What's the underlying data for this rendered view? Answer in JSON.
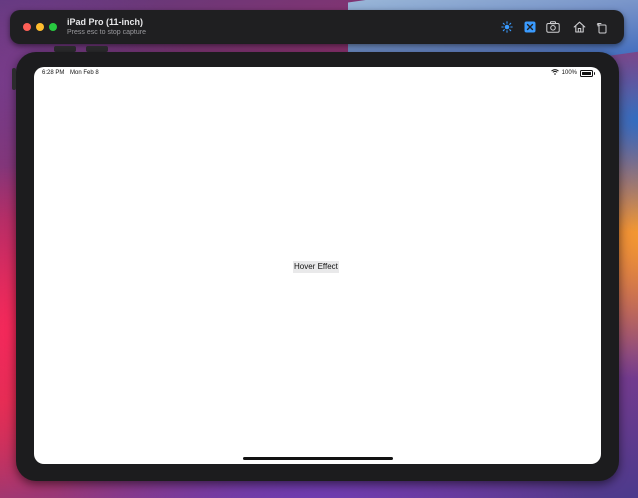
{
  "simulator": {
    "title": "iPad Pro (11-inch)",
    "subtitle": "Press esc to stop capture",
    "toolbar_icons": [
      "appearance-icon",
      "simulator-app-icon",
      "screenshot-icon",
      "home-icon",
      "rotate-icon"
    ]
  },
  "status_bar": {
    "time": "6:28 PM",
    "date": "Mon Feb 8",
    "battery_percent": "100%"
  },
  "content": {
    "button_label": "Hover Effect"
  },
  "colors": {
    "titlebar_bg": "#1f1f21",
    "device_bezel": "#1c1c1e",
    "screen_bg": "#ffffff",
    "button_bg": "#e9e9ea",
    "accent_blue": "#3a9bff"
  }
}
